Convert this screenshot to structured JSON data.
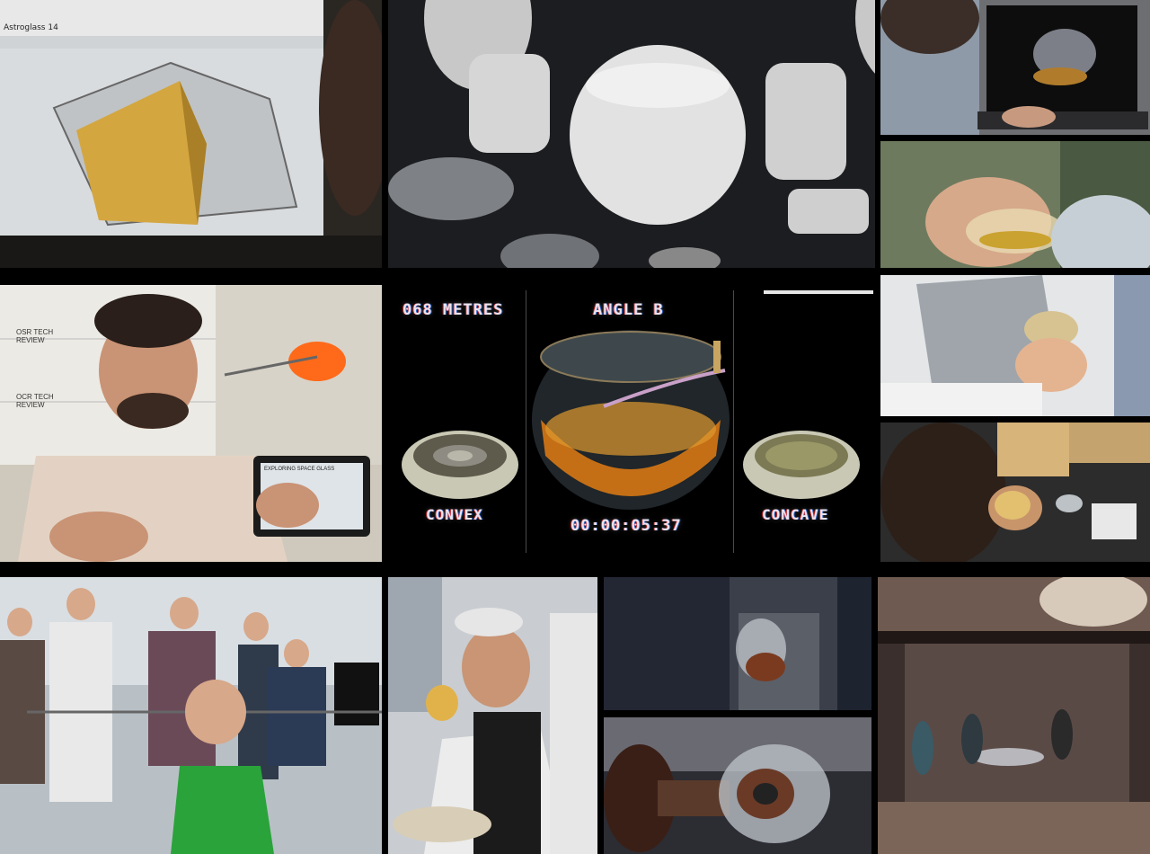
{
  "hud": {
    "distance_readout": "068 METRES",
    "angle_readout": "ANGLE B",
    "timer_readout": "00:00:05:37",
    "left_label": "CONVEX",
    "right_label": "CONCAVE"
  },
  "laptop_screen": {
    "app_title": "Astroglass 14"
  },
  "whiteboard": {
    "note_1": "OSR TECH REVIEW",
    "note_2": "OCR TECH REVIEW"
  },
  "tablet": {
    "heading": "EXPLORING SPACE GLASS"
  }
}
